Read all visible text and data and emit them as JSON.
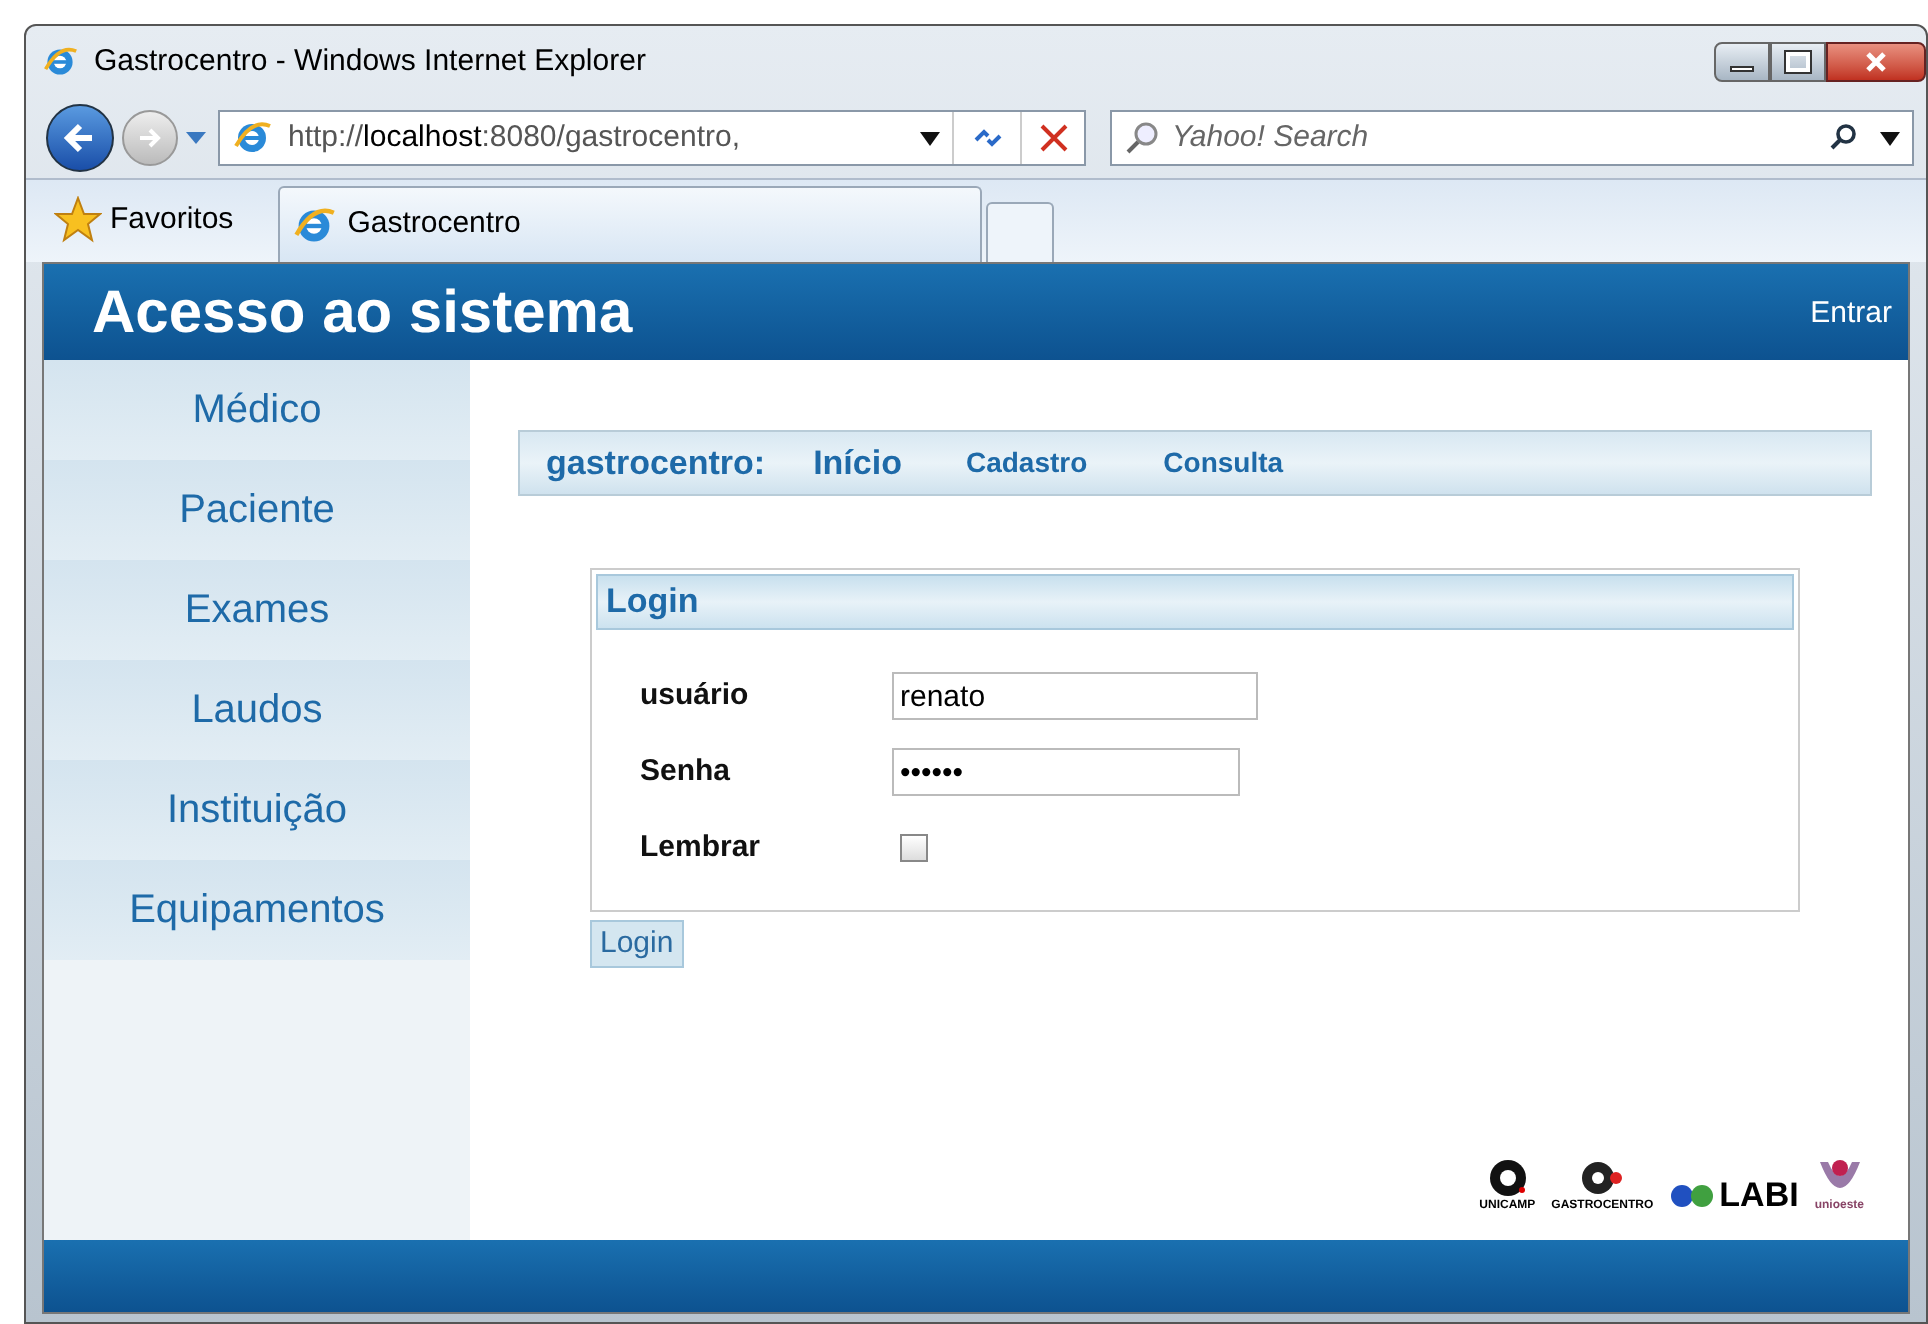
{
  "window": {
    "title": "Gastrocentro - Windows Internet Explorer"
  },
  "address_bar": {
    "url_prefix": "http://",
    "url_host": "localhost",
    "url_rest": ":8080/gastrocentro,"
  },
  "search": {
    "placeholder": "Yahoo! Search"
  },
  "favorites": {
    "label": "Favoritos"
  },
  "tabs": [
    {
      "label": "Gastrocentro",
      "selected": true
    }
  ],
  "header": {
    "title": "Acesso ao sistema",
    "link": "Entrar"
  },
  "sidebar": {
    "items": [
      {
        "label": "Médico"
      },
      {
        "label": "Paciente"
      },
      {
        "label": "Exames"
      },
      {
        "label": "Laudos"
      },
      {
        "label": "Instituição"
      },
      {
        "label": "Equipamentos"
      }
    ]
  },
  "nav": {
    "brand": "gastrocentro:",
    "links": [
      {
        "label": "Início",
        "kind": "big"
      },
      {
        "label": "Cadastro",
        "kind": "small"
      },
      {
        "label": "Consulta",
        "kind": "small"
      }
    ]
  },
  "login": {
    "title": "Login",
    "fields": [
      {
        "label": "usuário",
        "kind": "text",
        "value": "renato"
      },
      {
        "label": "Senha",
        "kind": "password",
        "value": "••••••"
      },
      {
        "label": "Lembrar",
        "kind": "checkbox",
        "checked": false
      }
    ],
    "button": "Login"
  },
  "logos": [
    {
      "kind": "unicamp",
      "text": "UNICAMP"
    },
    {
      "kind": "gastro",
      "text": "GASTROCENTRO"
    },
    {
      "kind": "labi",
      "text": "LABI"
    },
    {
      "kind": "unioeste",
      "text": "unioeste"
    }
  ]
}
